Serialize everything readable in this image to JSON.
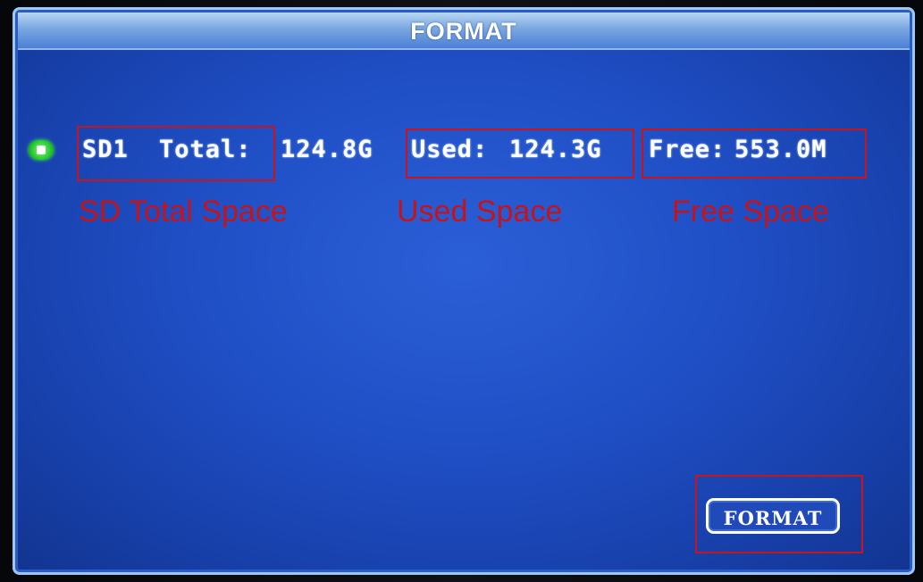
{
  "window": {
    "title": "FORMAT"
  },
  "disk": {
    "name_label": "SD1",
    "total_label": "Total:",
    "total_value": "124.8G",
    "used_label": "Used:",
    "used_value": "124.3G",
    "free_label": "Free:",
    "free_value": "553.0M",
    "selected": true
  },
  "annotations": {
    "total": "SD Total Space",
    "used": "Used Space",
    "free": "Free Space",
    "color": "#c4141a"
  },
  "actions": {
    "format_label": "FORMAT"
  },
  "colors": {
    "screen_bg": "#1f4ec4",
    "title_bar": "#7aa6e0",
    "radio_green": "#28c82e",
    "highlight_red": "#c9141a"
  }
}
